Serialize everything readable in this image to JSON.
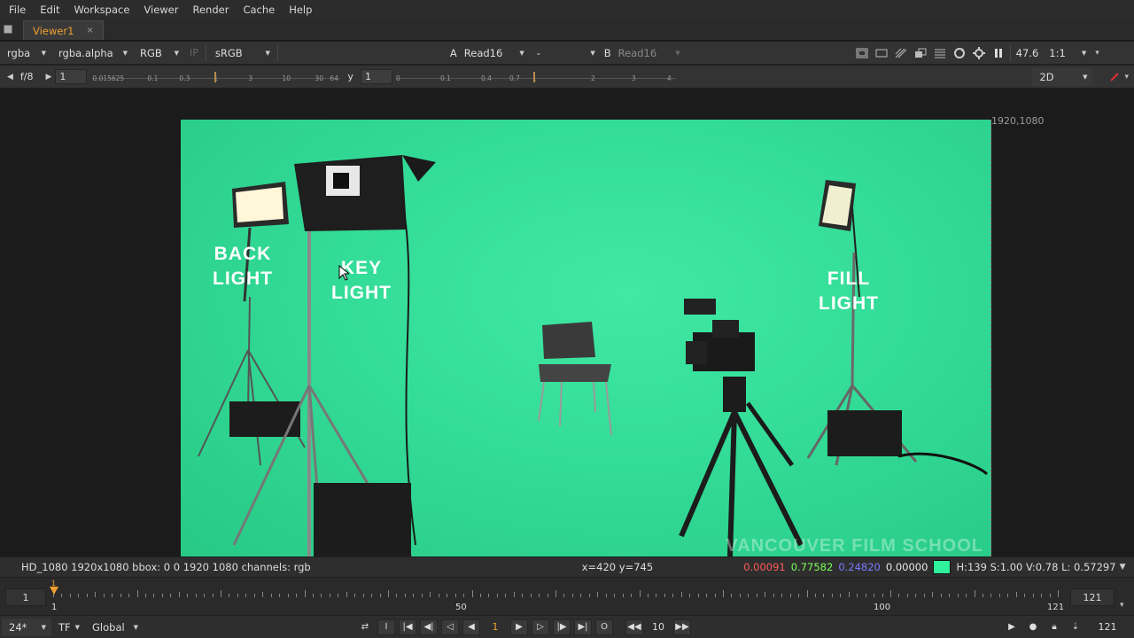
{
  "menu": [
    "File",
    "Edit",
    "Workspace",
    "Viewer",
    "Render",
    "Cache",
    "Help"
  ],
  "tab": {
    "label": "Viewer1",
    "close": "×"
  },
  "toolbar1": {
    "channels": "rgba",
    "alpha": "rgba.alpha",
    "display_channels": "RGB",
    "ip_label": "IP",
    "colorspace": "sRGB",
    "a_label": "A",
    "a_input": "Read16",
    "compare_mode": "-",
    "b_label": "B",
    "b_input": "Read16",
    "zoom": "47.6",
    "ratio": "1:1"
  },
  "toolbar2": {
    "fstop": "f/8",
    "gain_value": "1",
    "gain_ticks": [
      "0.015625",
      "0.1",
      "0.3",
      "1",
      "3",
      "10",
      "30",
      "64"
    ],
    "y_label": "y",
    "gamma_value": "1",
    "gamma_ticks": [
      "0",
      "0.1",
      "0.4",
      "0.7",
      "1",
      "2",
      "3",
      "4"
    ],
    "view_mode": "2D"
  },
  "viewer": {
    "resolution_label": "1920,1080",
    "labels": {
      "back_light": [
        "BACK",
        "LIGHT"
      ],
      "key_light": [
        "KEY",
        "LIGHT"
      ],
      "fill_light": [
        "FILL",
        "LIGHT"
      ]
    },
    "watermark": "VANCOUVER FILM SCHOOL"
  },
  "infobar": {
    "format": "HD_1080 1920x1080  bbox: 0 0 1920 1080 channels: rgb",
    "coords": "x=420 y=745",
    "r": "0.00091",
    "g": "0.77582",
    "b": "0.24820",
    "a": "0.00000",
    "swatch_color": "#2ff39a",
    "hsvl": "H:139 S:1.00 V:0.78  L: 0.57297"
  },
  "timeline": {
    "start_field": "1",
    "current_marker": "1",
    "labels": [
      "1",
      "50",
      "100",
      "121"
    ],
    "end_field": "121"
  },
  "playbar": {
    "fps": "24*",
    "tf": "TF",
    "scope": "Global",
    "in_label": "I",
    "current_frame": "1",
    "out_label": "O",
    "step": "10",
    "end_frame": "121"
  }
}
